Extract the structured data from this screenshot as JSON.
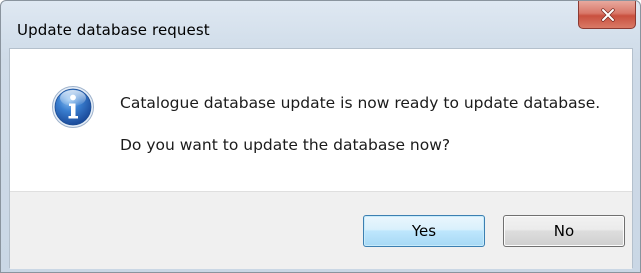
{
  "window": {
    "title": "Update database request",
    "close_icon": "close-icon"
  },
  "message": {
    "icon": "info-icon",
    "line1": "Catalogue database update is now ready to update database.",
    "line2": "Do you want to update the database now?"
  },
  "buttons": {
    "yes_label": "Yes",
    "no_label": "No"
  },
  "colors": {
    "close_button": "#c9503f",
    "default_button_border": "#3c7fb1",
    "info_icon": "#2f6cc0"
  }
}
